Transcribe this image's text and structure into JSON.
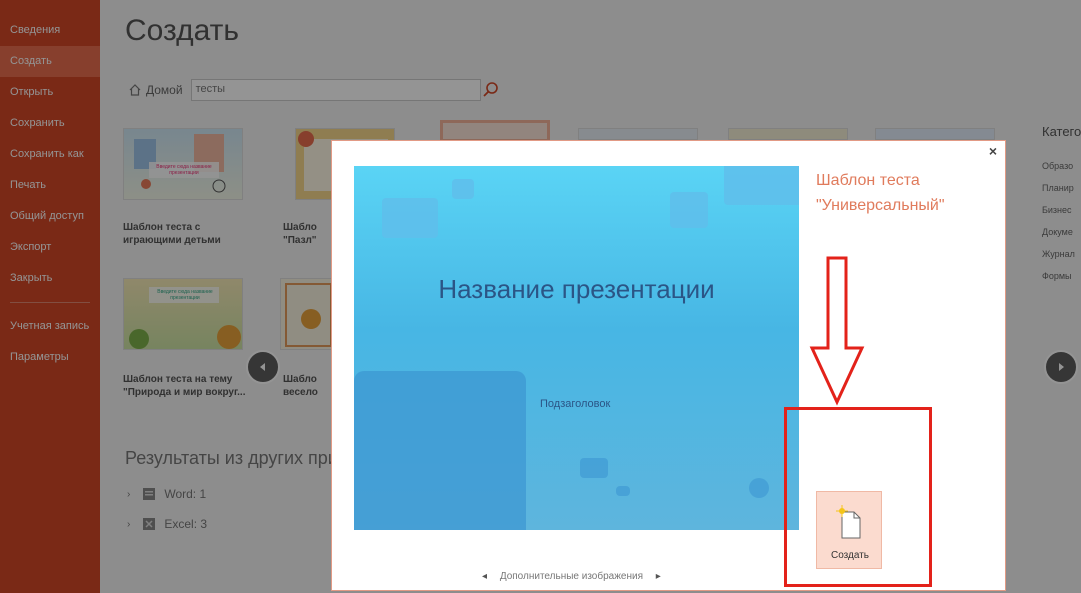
{
  "sidebar": {
    "items": [
      {
        "label": "Сведения"
      },
      {
        "label": "Создать"
      },
      {
        "label": "Открыть"
      },
      {
        "label": "Сохранить"
      },
      {
        "label": "Сохранить как"
      },
      {
        "label": "Печать"
      },
      {
        "label": "Общий доступ"
      },
      {
        "label": "Экспорт"
      },
      {
        "label": "Закрыть"
      }
    ],
    "items2": [
      {
        "label": "Учетная запись"
      },
      {
        "label": "Параметры"
      }
    ]
  },
  "main": {
    "title": "Создать",
    "home_label": "Домой",
    "search_value": "тесты",
    "templates": [
      {
        "caption": "Шаблон теста с играющими детьми"
      },
      {
        "caption": "Шабло \"Пазл\""
      },
      {
        "caption": "Шаблон теста на тему \"Природа и мир вокруг..."
      },
      {
        "caption": "Шабло весело"
      }
    ],
    "thumb_text_1": "Введите сюда название презентации",
    "thumb_text_2": "Введите сюда название презентации",
    "other_results_title": "Результаты из других прило",
    "results": [
      {
        "label": "Word:  1"
      },
      {
        "label": "Excel:  3"
      }
    ],
    "categories_title": "Катего",
    "categories": [
      "Образо",
      "Планир",
      "Бизнес",
      "Докуме",
      "Журнал",
      "Формы"
    ]
  },
  "dialog": {
    "template_title_line1": "Шаблон теста",
    "template_title_line2": "\"Универсальный\"",
    "preview_title": "Название презентации",
    "preview_subtitle": "Подзаголовок",
    "more_images": "Дополнительные изображения",
    "create_label": "Создать",
    "close_symbol": "×"
  },
  "colors": {
    "accent": "#d24726",
    "accent_light": "#e86d4e",
    "dialog_title": "#e07b5c",
    "annotation_red": "#e3221a"
  }
}
